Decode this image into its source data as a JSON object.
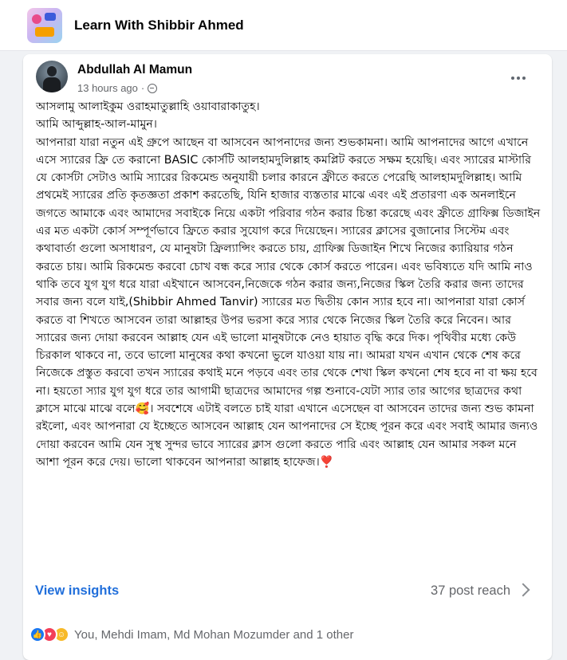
{
  "group": {
    "name": "Learn With Shibbir Ahmed"
  },
  "post": {
    "author": "Abdullah Al Mamun",
    "time": "13 hours ago",
    "audience_icon": "globe-icon",
    "body": [
      "আসলামু আলাইকুম ওরাহমাতুল্লাহি ওয়াবারাকাতুহ।",
      "আমি আব্দুল্লাহ-আল-মামুন।",
      "আপনারা যারা নতুন এই গ্রুপে আছেন বা আসবেন আপনাদের জন্য শুভকামনা। আমি আপনাদের আগে এখানে এসে স্যারের ফ্রি তে করানো BASIC কোর্সটি আলহামদুলিল্লাহ কমপ্লিট করতে সক্ষম হয়েছি। এবং স্যারের মাস্টারি যে কোর্সটা সেটাও আমি স্যারের রিকমেন্ড অনুযায়ী চলার কারনে ফ্রীতে করতে পেরেছি আলহামদুলিল্লাহ।  আমি প্রথমেই স্যারের প্রতি কৃতজ্ঞতা প্রকাশ করতেছি, যিনি হাজার ব্যস্ততার মাঝে এবং এই প্রতারণা এক অনলাইনে জগতে আমাকে এবং আমাদের সবাইকে নিয়ে একটা পরিবার গঠন করার চিন্তা করেছে এবং ফ্রীতে গ্রাফিক্স ডিজাইন এর মত একটা কোর্স সম্পূর্ণভাবে ফ্রিতে করার সুযোগ করে দিয়েছেন। স্যারের ক্লাসের বুজানোর সিস্টেম এবং কথাবার্তা গুলো অসাধারণ, যে মানুষটা ফ্রিল্যান্সিং করতে চায়, গ্রাফিক্স ডিজাইন শিখে নিজের ক্যারিয়ার গঠন করতে চায়। আমি রিকমেন্ড করবো চোখ বন্ধ করে স্যার থেকে কোর্স করতে পারেন। এবং ভবিষ্যতে যদি আমি নাও থাকি তবে যুগ যুগ ধরে যারা এইখানে আসবেন,নিজেকে গঠন করার জন্য,নিজের স্কিল তৈরি করার জন্য তাদের সবার জন্য বলে যাই,(Shibbir Ahmed Tanvir) স্যারের মত দ্বিতীয় কোন স্যার হবে না। আপনারা যারা কোর্স করতে বা শিখতে আসবেন তারা আল্লাহর উপর ভরসা করে স্যার থেকে নিজের স্কিল তৈরি করে নিবেন। আর স্যারের জন্য দোয়া করবেন আল্লাহ যেন এই ভালো মানুষটাকে নেও হায়াত বৃদ্ধি করে দিক। পৃথিবীর মধ্যে কেউ চিরকাল থাকবে না, তবে ভালো মানুষের কথা কখনো ভুলে যাওয়া যায় না। আমরা যখন এখান থেকে শেষ করে নিজেকে প্রস্তুত করবো তখন স্যারের কথাই মনে পড়বে এবং তার থেকে শেখা স্কিল কখনো শেষ হবে না বা ক্ষয় হবে না। হয়তো স্যার যুগ যুগ ধরে তার আগামী ছাত্রদের আমাদের গল্প শুনাবে-যেটা স্যার তার আগের ছাত্রদের কথা ক্লাসে মাঝে মাঝে বলে🥰। সবশেষে এটাই বলতে চাই যারা এখানে এসেছেন বা আসবেন তাদের জন্য শুভ কামনা রইলো, এবং আপনারা যে ইচ্ছেতে আসবেন আল্লাহ যেন আপনাদের সে ইচ্ছে পূরন করে এবং সবাই আমার জন্যও দোয়া করবেন আমি যেন সুস্থ সুন্দর ভাবে স্যারের ক্লাস গুলো করতে পারি এবং আল্লাহ যেন আমার সকল মনে আশা পূরন করে দেয়। ভালো থাকবেন আপনারা আল্লাহ হাফেজ।❣️"
    ],
    "view_insights": "View insights",
    "post_reach": "37 post reach",
    "reactors": "You, Mehdi Imam, Md Mohan Mozumder and 1 other"
  },
  "colors": {
    "link": "#216fdb",
    "secondary_text": "#65676b",
    "background": "#f0f2f5"
  }
}
